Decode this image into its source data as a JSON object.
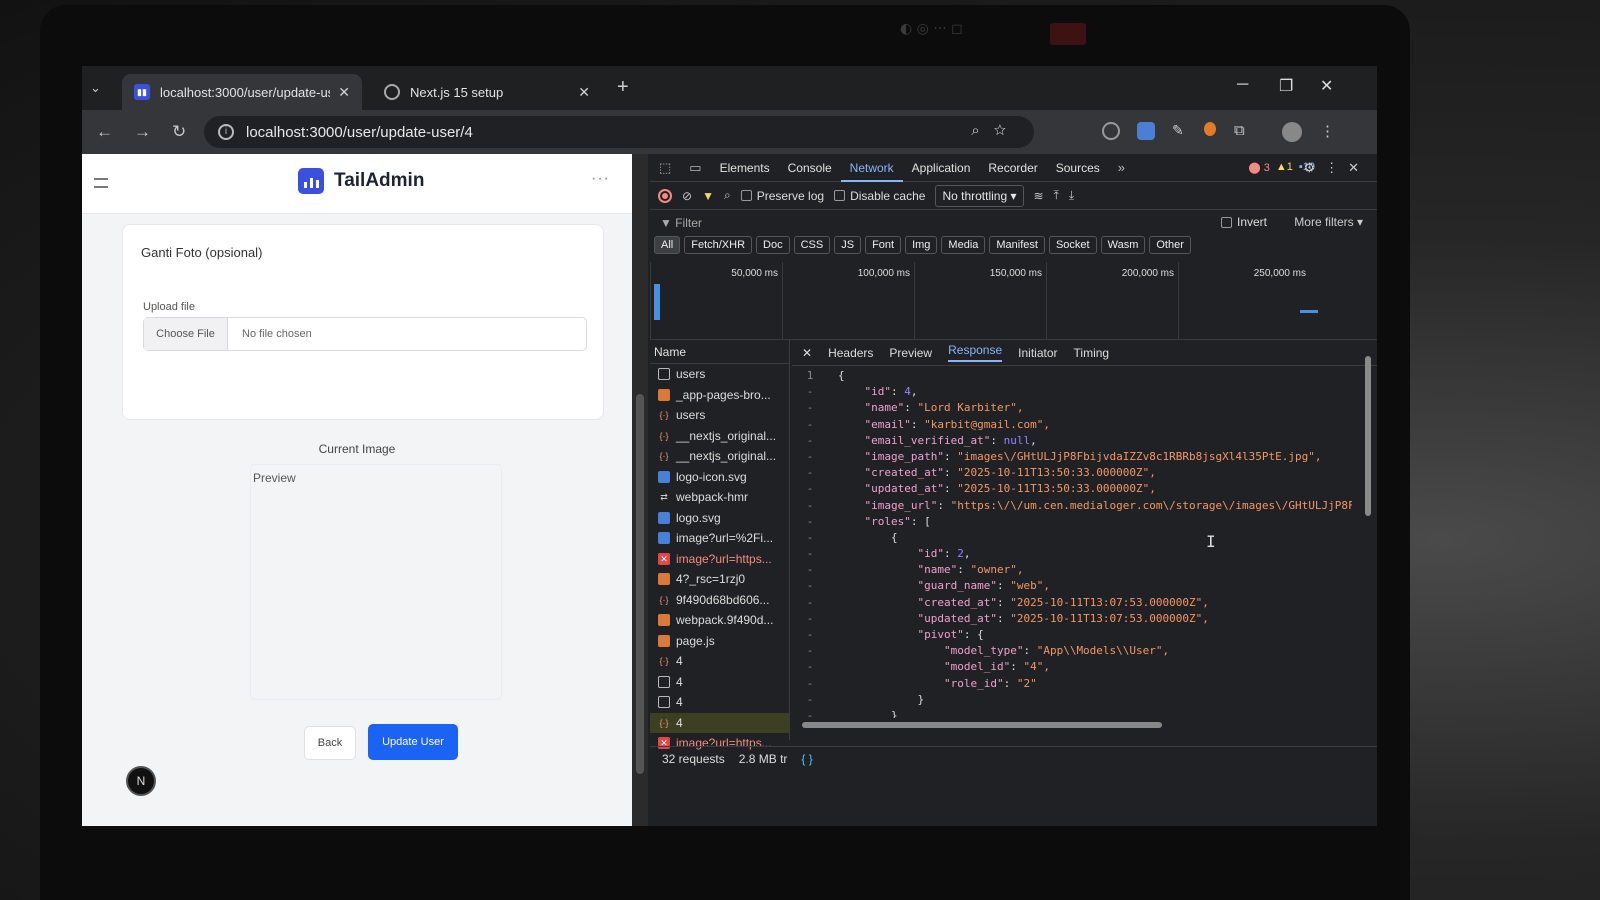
{
  "browser": {
    "tabs": [
      {
        "title": "localhost:3000/user/update-us",
        "active": true
      },
      {
        "title": "Next.js 15 setup",
        "active": false
      }
    ],
    "url": "localhost:3000/user/update-user/4"
  },
  "app": {
    "brand": "TailAdmin",
    "photo_card_title": "Ganti Foto (opsional)",
    "upload_label": "Upload file",
    "choose_file": "Choose File",
    "no_file": "No file chosen",
    "current_image_label": "Current Image",
    "preview_alt": "Preview",
    "back_button": "Back",
    "update_button": "Update User",
    "avatar_letter": "N",
    "accent": "#3c50e0"
  },
  "devtools": {
    "tabs": [
      "Elements",
      "Console",
      "Network",
      "Application",
      "Recorder",
      "Sources"
    ],
    "active_tab": "Network",
    "errors": "3",
    "warnings": "1",
    "infos": "10",
    "preserve_log": "Preserve log",
    "disable_cache": "Disable cache",
    "throttling": "No throttling",
    "filter_placeholder": "Filter",
    "invert": "Invert",
    "more_filters": "More filters",
    "types": [
      "All",
      "Fetch/XHR",
      "Doc",
      "CSS",
      "JS",
      "Font",
      "Img",
      "Media",
      "Manifest",
      "Socket",
      "Wasm",
      "Other"
    ],
    "timeline_ticks": [
      "50,000 ms",
      "100,000 ms",
      "150,000 ms",
      "200,000 ms",
      "250,000 ms"
    ],
    "name_header": "Name",
    "requests": [
      {
        "name": "users",
        "icon": "doc",
        "error": false
      },
      {
        "name": "_app-pages-bro...",
        "icon": "script",
        "error": false
      },
      {
        "name": "users",
        "icon": "fetch",
        "error": false
      },
      {
        "name": "__nextjs_original...",
        "icon": "fetch",
        "error": false
      },
      {
        "name": "__nextjs_original...",
        "icon": "fetch",
        "error": false
      },
      {
        "name": "logo-icon.svg",
        "icon": "img",
        "error": false
      },
      {
        "name": "webpack-hmr",
        "icon": "socket",
        "error": false
      },
      {
        "name": "logo.svg",
        "icon": "img",
        "error": false
      },
      {
        "name": "image?url=%2Fi...",
        "icon": "img",
        "error": false
      },
      {
        "name": "image?url=https...",
        "icon": "error",
        "error": true
      },
      {
        "name": "4?_rsc=1rzj0",
        "icon": "script",
        "error": false
      },
      {
        "name": "9f490d68bd606...",
        "icon": "fetch",
        "error": false
      },
      {
        "name": "webpack.9f490d...",
        "icon": "script",
        "error": false
      },
      {
        "name": "page.js",
        "icon": "script",
        "error": false
      },
      {
        "name": "4",
        "icon": "fetch",
        "error": false
      },
      {
        "name": "4",
        "icon": "doc",
        "error": false
      },
      {
        "name": "4",
        "icon": "doc",
        "error": false
      },
      {
        "name": "4",
        "icon": "fetch",
        "error": false,
        "selected": true
      },
      {
        "name": "image?url=https...",
        "icon": "error",
        "error": true
      }
    ],
    "detail_tabs": [
      "Headers",
      "Preview",
      "Response",
      "Initiator",
      "Timing"
    ],
    "active_detail_tab": "Response",
    "response_lines": [
      "{",
      "    \"id\": 4,",
      "    \"name\": \"Lord Karbiter\",",
      "    \"email\": \"karbit@gmail.com\",",
      "    \"email_verified_at\": null,",
      "    \"image_path\": \"images\\/GHtULJjP8FbijvdaIZZv8c1RBRb8jsgXl4l35PtE.jpg\",",
      "    \"created_at\": \"2025-10-11T13:50:33.000000Z\",",
      "    \"updated_at\": \"2025-10-11T13:50:33.000000Z\",",
      "    \"image_url\": \"https:\\/\\/um.cen.medialoger.com\\/storage\\/images\\/GHtULJjP8F",
      "    \"roles\": [",
      "        {",
      "            \"id\": 2,",
      "            \"name\": \"owner\",",
      "            \"guard_name\": \"web\",",
      "            \"created_at\": \"2025-10-11T13:07:53.000000Z\",",
      "            \"updated_at\": \"2025-10-11T13:07:53.000000Z\",",
      "            \"pivot\": {",
      "                \"model_type\": \"App\\\\Models\\\\User\",",
      "                \"model_id\": \"4\",",
      "                \"role_id\": \"2\"",
      "            }",
      "        }"
    ],
    "status_requests": "32 requests",
    "status_transfer": "2.8 MB tr"
  }
}
